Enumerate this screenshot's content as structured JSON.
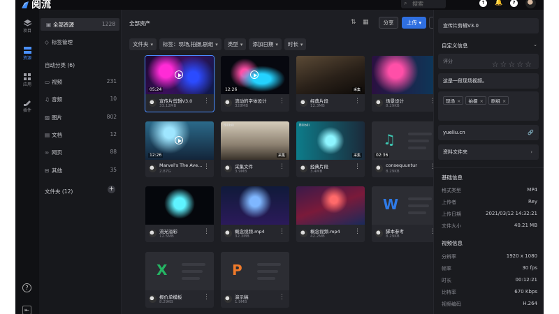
{
  "app": {
    "name": "阅流",
    "search_placeholder": "搜索"
  },
  "rail": [
    {
      "label": "项目",
      "icon": "layers-icon"
    },
    {
      "label": "资源",
      "icon": "resource-icon"
    },
    {
      "label": "应用",
      "icon": "apps-icon"
    },
    {
      "label": "插件",
      "icon": "plugin-icon"
    }
  ],
  "sidebar": {
    "all_label": "全部资源",
    "all_count": "1228",
    "tag_manage": "标签管理",
    "auto_cat": "自动分类 (6)",
    "categories": [
      {
        "label": "视频",
        "count": "231"
      },
      {
        "label": "音频",
        "count": "10"
      },
      {
        "label": "图片",
        "count": "802"
      },
      {
        "label": "文档",
        "count": "12"
      },
      {
        "label": "网页",
        "count": "88"
      },
      {
        "label": "其他",
        "count": "35"
      }
    ],
    "folders": "文件夹 (12)"
  },
  "main": {
    "title": "全部资产",
    "share": "分享",
    "upload": "上传",
    "filters": [
      "文件夹",
      "标签：现场,拍摄,剧组",
      "类型",
      "添加日期",
      "时长"
    ]
  },
  "cards": [
    {
      "name": "宣传片剪辑V3.0",
      "size": "33.12MB",
      "dur": "05:24",
      "badge": "",
      "thumb": "neon",
      "play": true
    },
    {
      "name": "流动的字体设计",
      "size": "328MB",
      "dur": "12:26",
      "badge": "",
      "thumb": "type",
      "play": true
    },
    {
      "name": "经典片段",
      "size": "12.3MB",
      "dur": "",
      "badge": "采集",
      "thumb": "studio"
    },
    {
      "name": "场景设计",
      "size": "8.29KB",
      "dur": "",
      "badge": "",
      "thumb": "pinkroom"
    },
    {
      "name": "Marvel's The Ave...",
      "size": "2.87G",
      "dur": "12:26",
      "badge": "",
      "thumb": "concert",
      "play": true
    },
    {
      "name": "采集文件",
      "size": "3.9MB",
      "dur": "",
      "badge": "采集",
      "thumb": "office",
      "tl": "Bilibili"
    },
    {
      "name": "经典片段",
      "size": "3.4MB",
      "dur": "",
      "badge": "采集",
      "thumb": "prism",
      "tl": "Bilibili"
    },
    {
      "name": "consequuntur",
      "size": "8.29KB",
      "dur": "02:36",
      "badge": "",
      "thumb": "audio"
    },
    {
      "name": "流光溢彩",
      "size": "12.5MB",
      "dur": "",
      "badge": "",
      "thumb": "jelly"
    },
    {
      "name": "概念视频.mp4",
      "size": "32.3MB",
      "dur": "",
      "badge": "",
      "thumb": "stage"
    },
    {
      "name": "概念视频.mp4",
      "size": "42.2MB",
      "dur": "",
      "badge": "",
      "thumb": "tunnel"
    },
    {
      "name": "脚本参考",
      "size": "8.29KB",
      "dur": "",
      "badge": "",
      "thumb": "word"
    },
    {
      "name": "报价单模板",
      "size": "8.29KB",
      "dur": "",
      "badge": "",
      "thumb": "excel"
    },
    {
      "name": "演示稿",
      "size": "1.9MB",
      "dur": "",
      "badge": "",
      "thumb": "ppt"
    }
  ],
  "panel": {
    "title": "宣传片剪辑V3.0",
    "custom_info": "自定义信息",
    "rating_label": "评分",
    "description": "这是一段现场视频。",
    "tags": [
      "现场",
      "拍摄",
      "剧组"
    ],
    "link": "yueliu.cn",
    "folder": "资料文件夹",
    "basic_head": "基础信息",
    "basic": [
      {
        "k": "格式类型",
        "v": "MP4"
      },
      {
        "k": "上传者",
        "v": "Rey"
      },
      {
        "k": "上传日期",
        "v": "2021/03/12 14:32:21"
      },
      {
        "k": "文件大小",
        "v": "40.21 MB"
      }
    ],
    "video_head": "视频信息",
    "video": [
      {
        "k": "分辨率",
        "v": "1920 x 1080"
      },
      {
        "k": "帧率",
        "v": "30 fps"
      },
      {
        "k": "时长",
        "v": "00:12:21"
      },
      {
        "k": "比特率",
        "v": "670 Kbps"
      },
      {
        "k": "视频编码",
        "v": "H.264"
      }
    ]
  }
}
